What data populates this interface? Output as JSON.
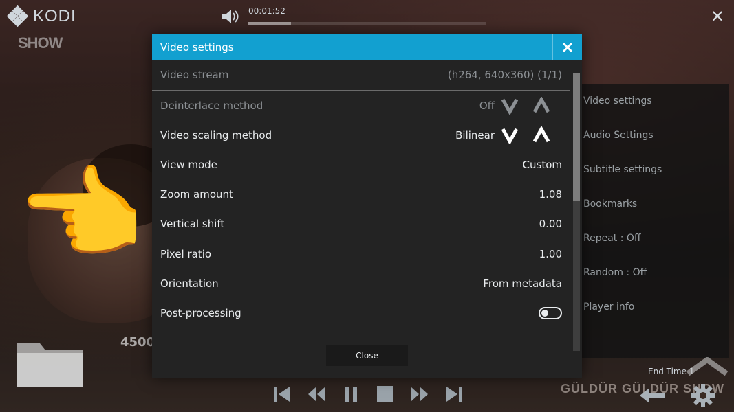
{
  "app": {
    "logo_text": "KODI",
    "channel_logo": "SHOW"
  },
  "player": {
    "elapsed": "00:01:52",
    "progress_fraction": 0.18,
    "end_time": "End Time 1",
    "watermark": "GÜLDÜR GÜLDÜR SHOW",
    "left_number": "4500"
  },
  "side_menu": {
    "items": [
      {
        "label": "Video settings"
      },
      {
        "label": "Audio Settings"
      },
      {
        "label": "Subtitle settings"
      },
      {
        "label": "Bookmarks"
      },
      {
        "label": "Repeat : Off"
      },
      {
        "label": "Random : Off"
      },
      {
        "label": "Player info"
      }
    ]
  },
  "dialog": {
    "title": "Video settings",
    "close_label": "Close",
    "rows": [
      {
        "label": "Video stream",
        "value": "(h264, 640x360) (1/1)"
      },
      {
        "label": "Deinterlace method",
        "value": "Off"
      },
      {
        "label": "Video scaling method",
        "value": "Bilinear"
      },
      {
        "label": "View mode",
        "value": "Custom"
      },
      {
        "label": "Zoom amount",
        "value": "1.08"
      },
      {
        "label": "Vertical shift",
        "value": "0.00"
      },
      {
        "label": "Pixel ratio",
        "value": "1.00"
      },
      {
        "label": "Orientation",
        "value": "From metadata"
      },
      {
        "label": "Post-processing",
        "value": false
      }
    ],
    "scroll_fraction": 0.46
  },
  "icons": {
    "hand": "👉",
    "colors": {
      "accent": "#12a0d0",
      "dialog_bg": "#232323"
    }
  }
}
